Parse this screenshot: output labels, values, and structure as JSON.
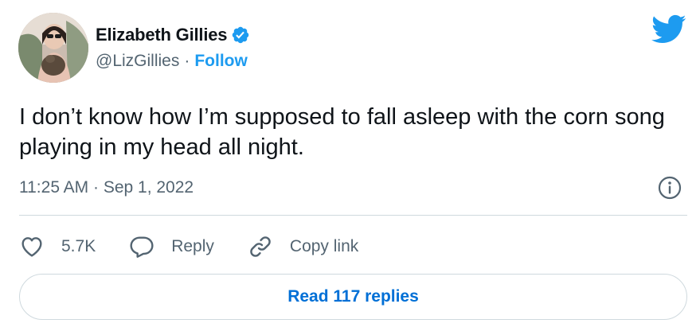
{
  "author": {
    "display_name": "Elizabeth Gillies",
    "handle": "@LizGillies",
    "separator": "·",
    "follow_label": "Follow",
    "verified": true
  },
  "tweet": {
    "text": "I don’t know how I’m supposed to fall asleep with the corn song playing in my head all night.",
    "timestamp": "11:25 AM · Sep 1, 2022"
  },
  "actions": {
    "like_count": "5.7K",
    "reply_label": "Reply",
    "copy_link_label": "Copy link"
  },
  "read_replies_label": "Read 117 replies",
  "icons": {
    "brand": "twitter-bird-icon",
    "verified": "verified-badge-icon",
    "info": "info-icon",
    "like": "heart-icon",
    "reply": "reply-bubble-icon",
    "copy_link": "link-icon"
  },
  "colors": {
    "accent": "#1d9bf0",
    "link_button_text": "#006fd6",
    "secondary_text": "#536471",
    "primary_text": "#0f1419",
    "border": "#cfd9de"
  }
}
